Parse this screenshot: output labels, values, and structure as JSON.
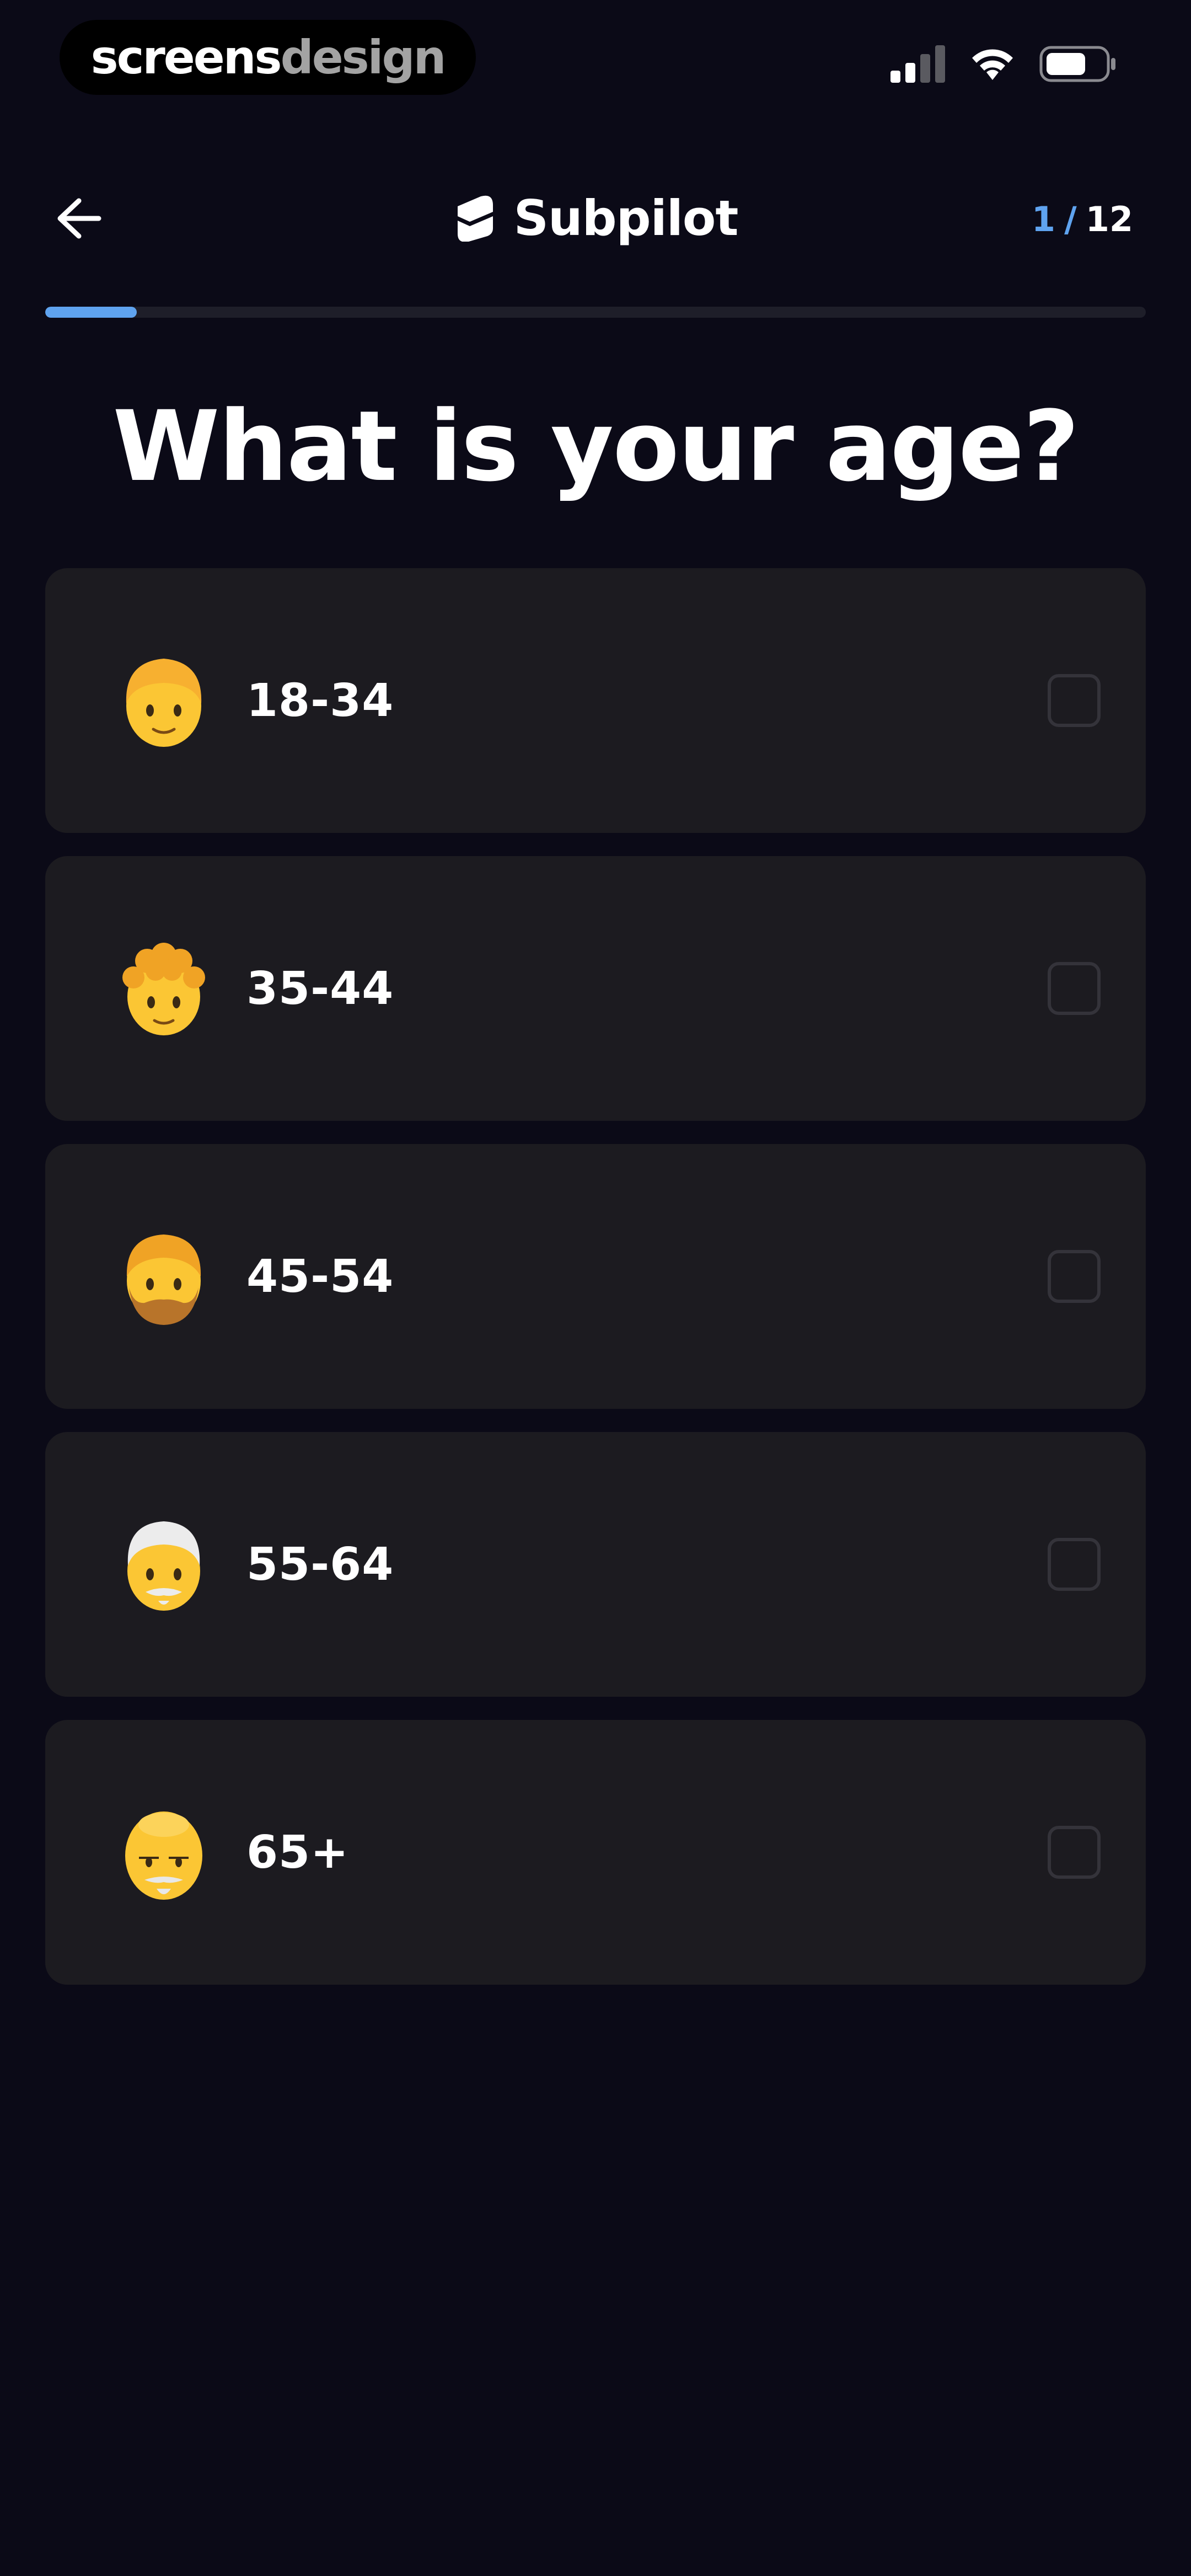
{
  "status_bar": {
    "watermark_part1": "screens",
    "watermark_part2": "design",
    "signal_icon": "signal-icon",
    "wifi_icon": "wifi-icon",
    "battery_icon": "battery-icon"
  },
  "header": {
    "back_icon": "arrow-left-icon",
    "brand_icon": "subpilot-logo-icon",
    "brand_name": "Subpilot",
    "progress_current": "1",
    "progress_separator": "/",
    "progress_total": "12",
    "progress_fraction": 0.0833
  },
  "question": {
    "title": "What is your age?"
  },
  "options": [
    {
      "label": "18-34",
      "emoji": "young-person-emoji",
      "checked": false
    },
    {
      "label": "35-44",
      "emoji": "curly-hair-person-emoji",
      "checked": false
    },
    {
      "label": "45-54",
      "emoji": "bearded-person-emoji",
      "checked": false
    },
    {
      "label": "55-64",
      "emoji": "white-hair-person-emoji",
      "checked": false
    },
    {
      "label": "65+",
      "emoji": "older-person-emoji",
      "checked": false
    }
  ],
  "colors": {
    "background": "#0b0a17",
    "card": "#1c1b20",
    "accent": "#5fa3ef",
    "checkbox_border": "#34333a",
    "emoji_skin": "#fbc634"
  }
}
